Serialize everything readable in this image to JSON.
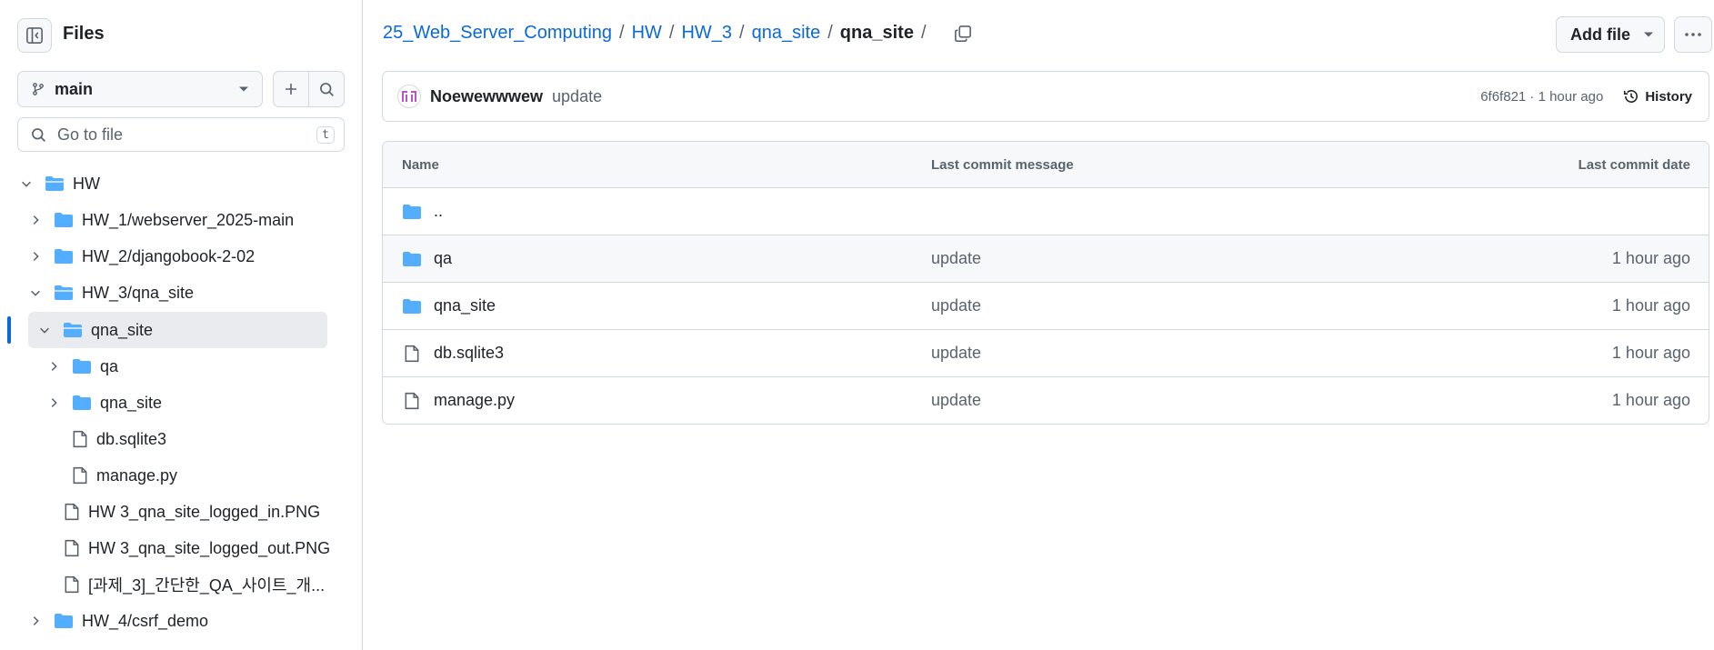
{
  "sidebar": {
    "title": "Files",
    "branch": "main",
    "search_placeholder": "Go to file",
    "search_shortcut": "t",
    "tree": [
      {
        "label": "HW",
        "type": "folder",
        "expanded": true
      },
      {
        "label": "HW_1/webserver_2025-main",
        "type": "folder",
        "expanded": false
      },
      {
        "label": "HW_2/djangobook-2-02",
        "type": "folder",
        "expanded": false
      },
      {
        "label": "HW_3/qna_site",
        "type": "folder",
        "expanded": true
      },
      {
        "label": "qna_site",
        "type": "folder",
        "expanded": true,
        "selected": true
      },
      {
        "label": "qa",
        "type": "folder",
        "expanded": false
      },
      {
        "label": "qna_site",
        "type": "folder",
        "expanded": false
      },
      {
        "label": "db.sqlite3",
        "type": "file"
      },
      {
        "label": "manage.py",
        "type": "file"
      },
      {
        "label": "HW 3_qna_site_logged_in.PNG",
        "type": "file"
      },
      {
        "label": "HW 3_qna_site_logged_out.PNG",
        "type": "file"
      },
      {
        "label": "[과제_3]_간단한_QA_사이트_개...",
        "type": "file"
      },
      {
        "label": "HW_4/csrf_demo",
        "type": "folder",
        "expanded": false
      }
    ]
  },
  "breadcrumb": {
    "links": [
      "25_Web_Server_Computing",
      "HW",
      "HW_3",
      "qna_site"
    ],
    "current": "qna_site",
    "trailing_sep": "/"
  },
  "toolbar": {
    "add_file_label": "Add file"
  },
  "commit": {
    "author": "Noewewwwew",
    "message": "update",
    "meta": "6f6f821 · 1 hour ago",
    "history_label": "History"
  },
  "table": {
    "headers": {
      "name": "Name",
      "message": "Last commit message",
      "date": "Last commit date"
    },
    "parent_label": "..",
    "rows": [
      {
        "name": "qa",
        "type": "folder",
        "message": "update",
        "date": "1 hour ago"
      },
      {
        "name": "qna_site",
        "type": "folder",
        "message": "update",
        "date": "1 hour ago"
      },
      {
        "name": "db.sqlite3",
        "type": "file",
        "message": "update",
        "date": "1 hour ago"
      },
      {
        "name": "manage.py",
        "type": "file",
        "message": "update",
        "date": "1 hour ago"
      }
    ]
  },
  "colors": {
    "accent": "#0969da",
    "folder": "#54aeff",
    "muted": "#59636e",
    "border": "#d1d9e0"
  }
}
